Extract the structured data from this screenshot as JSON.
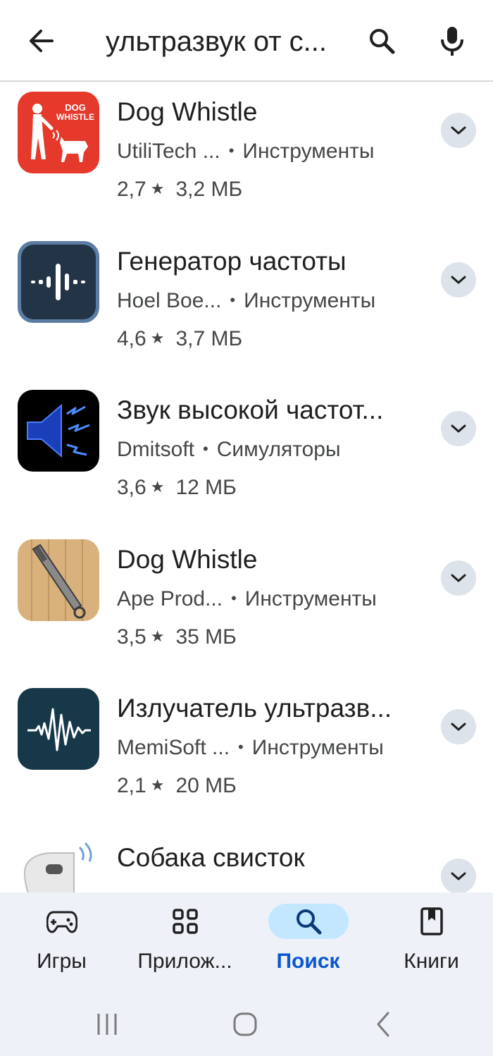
{
  "search": {
    "query": "ультразвук от с..."
  },
  "results": [
    {
      "title": "Dog Whistle",
      "developer": "UtiliTech ...",
      "category": "Инструменты",
      "rating": "2,7",
      "size": "3,2 МБ",
      "icon": "dog-whistle-red-icon",
      "icon_text_1": "DOG",
      "icon_text_2": "WHISTLE"
    },
    {
      "title": "Генератор частоты",
      "developer": "Hoel Boe...",
      "category": "Инструменты",
      "rating": "4,6",
      "size": "3,7 МБ",
      "icon": "frequency-wave-icon"
    },
    {
      "title": "Звук высокой частот...",
      "developer": "Dmitsoft",
      "category": "Симуляторы",
      "rating": "3,6",
      "size": "12 МБ",
      "icon": "speaker-lightning-icon"
    },
    {
      "title": "Dog Whistle",
      "developer": "Ape Prod...",
      "category": "Инструменты",
      "rating": "3,5",
      "size": "35 МБ",
      "icon": "whistle-wood-icon"
    },
    {
      "title": "Излучатель ультразв...",
      "developer": "MemiSoft ...",
      "category": "Инструменты",
      "rating": "2,1",
      "size": "20 МБ",
      "icon": "sound-wave-icon"
    },
    {
      "title": "Собака свисток",
      "icon": "white-whistle-icon"
    }
  ],
  "bottom_nav": [
    {
      "label": "Игры",
      "icon": "gamepad-icon",
      "active": false
    },
    {
      "label": "Прилож...",
      "icon": "apps-grid-icon",
      "active": false
    },
    {
      "label": "Поиск",
      "icon": "search-icon",
      "active": true
    },
    {
      "label": "Книги",
      "icon": "bookmark-icon",
      "active": false
    }
  ],
  "colors": {
    "accent": "#0b57d0",
    "active_pill": "#c2e7ff",
    "nav_background": "#eef2f8"
  }
}
